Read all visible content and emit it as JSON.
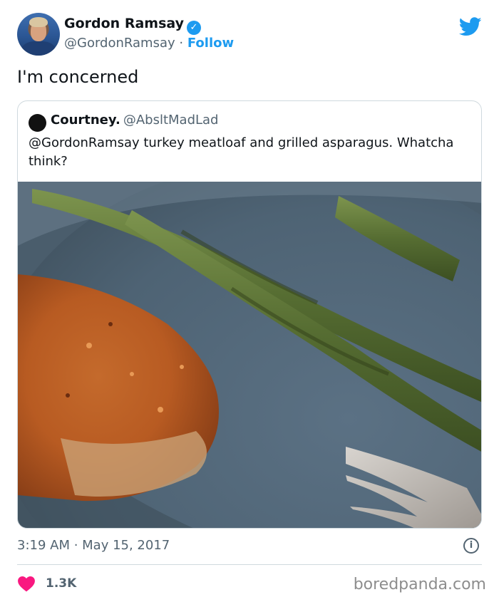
{
  "author": {
    "name": "Gordon Ramsay",
    "handle": "@GordonRamsay",
    "separator": "·",
    "follow_label": "Follow",
    "avatar": "profile-photo"
  },
  "tweet": {
    "text": "I'm concerned",
    "timestamp": "3:19 AM · May 15, 2017",
    "likes": "1.3K"
  },
  "quoted_tweet": {
    "name": "Courtney.",
    "handle": "@AbsltMadLad",
    "text": "@GordonRamsay turkey meatloaf and grilled asparagus. Whatcha think?"
  },
  "watermark": "boredpanda.com",
  "colors": {
    "accent": "#1d9bf0",
    "heart": "#f91880",
    "secondary_text": "#536471"
  }
}
